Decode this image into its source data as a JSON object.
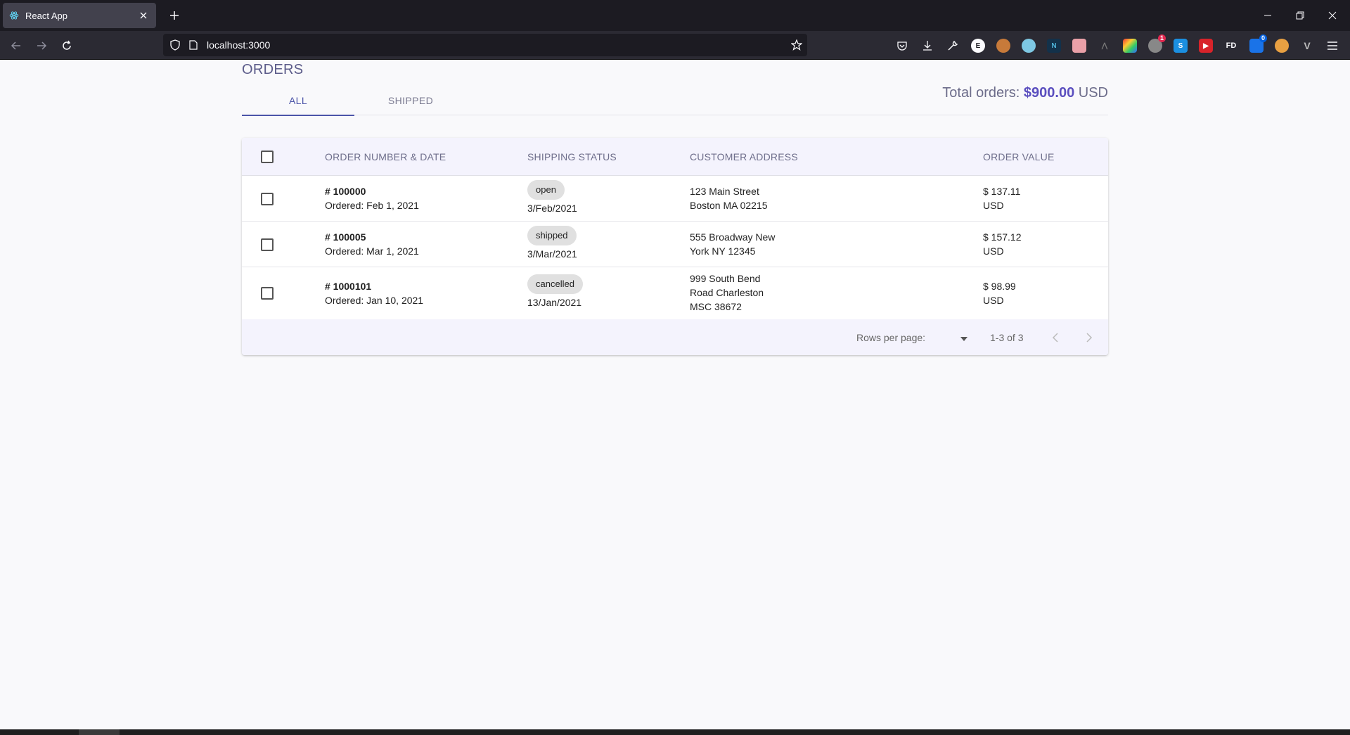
{
  "browser": {
    "tab_title": "React App",
    "url": "localhost:3000",
    "colors": {
      "chrome_bg": "#1c1b22",
      "toolbar_bg": "#2b2a33"
    },
    "extension_badges": [
      "1",
      "0"
    ]
  },
  "page": {
    "title": "ORDERS",
    "tabs": [
      {
        "label": "ALL",
        "active": true
      },
      {
        "label": "SHIPPED",
        "active": false
      }
    ],
    "total": {
      "label": "Total orders:",
      "amount": "$900.00",
      "currency": "USD"
    },
    "accent_color": "#4c55a8"
  },
  "table": {
    "headers": {
      "order": "ORDER NUMBER & DATE",
      "status": "SHIPPING STATUS",
      "address": "CUSTOMER ADDRESS",
      "value": "ORDER VALUE"
    },
    "rows": [
      {
        "order_no": "# 100000",
        "ordered": "Ordered: Feb 1, 2021",
        "status": "open",
        "status_date": "3/Feb/2021",
        "address": [
          "123 Main Street",
          "Boston MA 02215"
        ],
        "value": "$ 137.11",
        "currency": "USD"
      },
      {
        "order_no": "# 100005",
        "ordered": "Ordered: Mar 1, 2021",
        "status": "shipped",
        "status_date": "3/Mar/2021",
        "address": [
          "555 Broadway New",
          "York NY 12345"
        ],
        "value": "$ 157.12",
        "currency": "USD"
      },
      {
        "order_no": "# 1000101",
        "ordered": "Ordered: Jan 10, 2021",
        "status": "cancelled",
        "status_date": "13/Jan/2021",
        "address": [
          "999 South Bend",
          "Road Charleston",
          "MSC 38672"
        ],
        "value": "$ 98.99",
        "currency": "USD"
      }
    ],
    "footer": {
      "rows_per_page_label": "Rows per page:",
      "range": "1-3 of 3"
    }
  }
}
